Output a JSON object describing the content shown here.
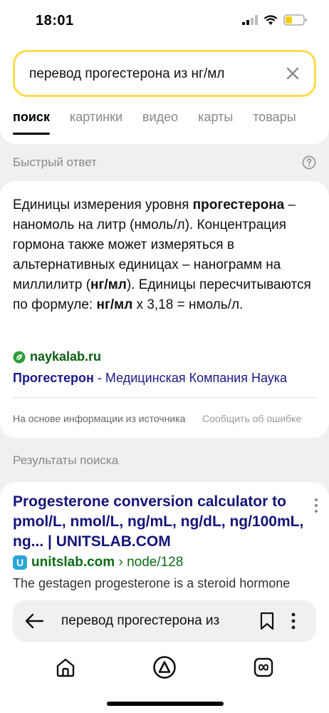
{
  "status_bar": {
    "time": "18:01"
  },
  "search": {
    "query": "перевод прогестерона из нг/мл"
  },
  "tabs": [
    "поиск",
    "картинки",
    "видео",
    "карты",
    "товары"
  ],
  "quick_answer": {
    "header": "Быстрый ответ",
    "t1": "Единицы измерения уровня",
    "t2b": "прогестерона",
    "t2": " – наномоль на литр (нмоль/л). Концентрация гормона также может измеряться в альтернативных единицах – нанограмм на миллилитр (",
    "t3b": "нг/мл",
    "t4": "). Единицы пересчитываются по формуле:",
    "t5b": "нг/мл",
    "t6": " x 3,18 = нмоль/л.",
    "source_domain": "naykalab.ru",
    "source_title_bold": "Прогестерон",
    "source_title_rest": " - Медицинская Компания Наука",
    "footer_left": "На основе информации из источника",
    "footer_right": "Сообщить об ошибке"
  },
  "results": {
    "header": "Результаты поиска",
    "items": [
      {
        "title": "Progesterone conversion calculator to pmol/L, nmol/L, ng/mL, ng/dL, ng/100mL, ng... | UNITSLAB.COM",
        "favicon_letter": "U",
        "domain": "unitslab.com",
        "path": " › node/128",
        "snippet": "The gestagen progesterone is a steroid hormone"
      }
    ]
  },
  "browser": {
    "address_text": "перевод прогестерона из"
  },
  "colors": {
    "accent_yellow": "#ffdb4d",
    "link_blue": "#14147a",
    "url_green": "#0a6b14"
  }
}
